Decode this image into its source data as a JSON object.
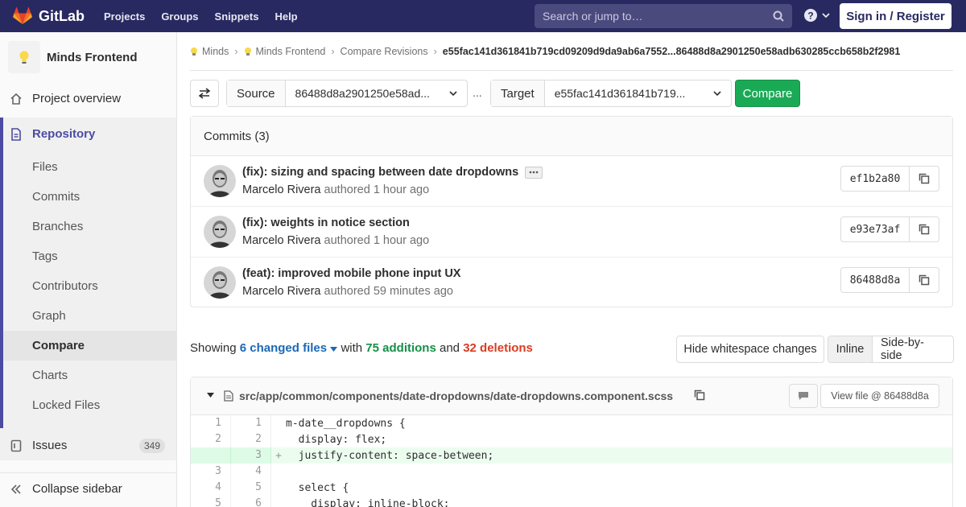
{
  "navbar": {
    "brand": "GitLab",
    "links": [
      "Projects",
      "Groups",
      "Snippets",
      "Help"
    ],
    "search_placeholder": "Search or jump to…",
    "signin": "Sign in / Register",
    "brand_color": "#292961"
  },
  "sidebar": {
    "project_name": "Minds Frontend",
    "overview": "Project overview",
    "repository": "Repository",
    "repo_items": [
      "Files",
      "Commits",
      "Branches",
      "Tags",
      "Contributors",
      "Graph",
      "Compare",
      "Charts",
      "Locked Files"
    ],
    "issues": "Issues",
    "issues_count": "349",
    "collapse": "Collapse sidebar"
  },
  "breadcrumb": {
    "items": [
      "Minds",
      "Minds Frontend",
      "Compare Revisions"
    ],
    "current": "e55fac141d361841b719cd09209d9da9ab6a7552...86488d8a2901250e58adb630285ccb658b2f2981"
  },
  "compare_bar": {
    "source_label": "Source",
    "source_value": "86488d8a2901250e58ad...",
    "ellipsis": "...",
    "target_label": "Target",
    "target_value": "e55fac141d361841b719...",
    "compare_button": "Compare"
  },
  "commits": {
    "header": "Commits (3)",
    "list": [
      {
        "title": "(fix): sizing and spacing between date dropdowns",
        "author": "Marcelo Rivera",
        "authored": "authored",
        "time": "1 hour ago",
        "sha": "ef1b2a80"
      },
      {
        "title": "(fix): weights in notice section",
        "author": "Marcelo Rivera",
        "authored": "authored",
        "time": "1 hour ago",
        "sha": "e93e73af"
      },
      {
        "title": "(feat): improved mobile phone input UX",
        "author": "Marcelo Rivera",
        "authored": "authored",
        "time": "59 minutes ago",
        "sha": "86488d8a"
      }
    ]
  },
  "summary": {
    "showing": "Showing",
    "changed_files": "6 changed files",
    "with": "with",
    "additions": "75 additions",
    "and": "and",
    "deletions": "32 deletions",
    "hide_whitespace": "Hide whitespace changes",
    "inline": "Inline",
    "side_by_side": "Side-by-side"
  },
  "file": {
    "path": "src/app/common/components/date-dropdowns/date-dropdowns.component.scss",
    "view_file": "View file @ 86488d8a",
    "lines": [
      {
        "old": "1",
        "new": "1",
        "sign": "",
        "code": "m-date__dropdowns {",
        "type": "context"
      },
      {
        "old": "2",
        "new": "2",
        "sign": "",
        "code": "  display: flex;",
        "type": "context"
      },
      {
        "old": "",
        "new": "3",
        "sign": "+",
        "code": "  justify-content: space-between;",
        "type": "added"
      },
      {
        "old": "3",
        "new": "4",
        "sign": "",
        "code": "",
        "type": "context"
      },
      {
        "old": "4",
        "new": "5",
        "sign": "",
        "code": "  select {",
        "type": "context"
      },
      {
        "old": "5",
        "new": "6",
        "sign": "",
        "code": "    display: inline-block;",
        "type": "context"
      }
    ]
  }
}
